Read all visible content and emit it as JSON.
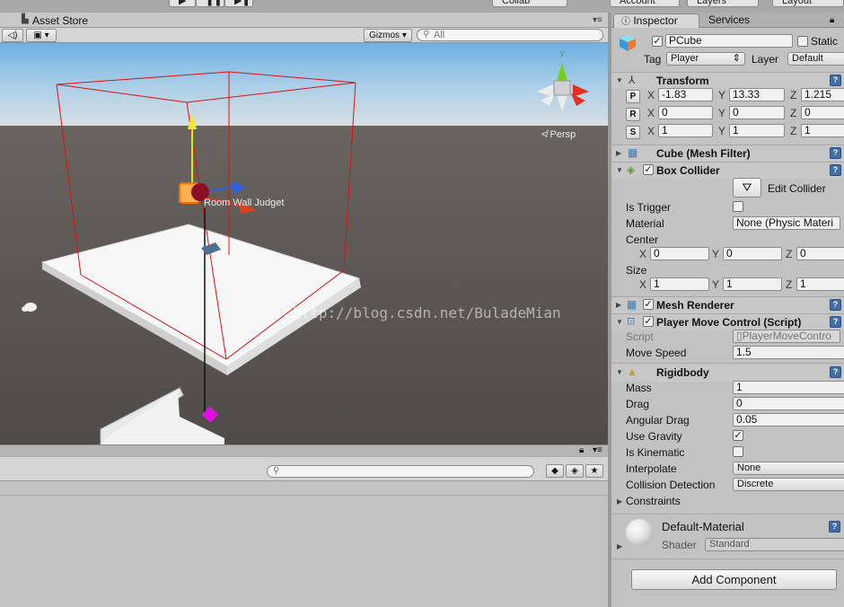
{
  "top": {
    "btn_collab": "Collab",
    "btn_account": "Account",
    "btn_layers": "Layers",
    "btn_layout": "Layout"
  },
  "scene": {
    "tab_asset_store": "Asset Store",
    "gizmos": "Gizmos",
    "search_placeholder": "All",
    "persp": "Persp",
    "object_label": "Room Wall Judget",
    "watermark": "http://blog.csdn.net/BuladeMian"
  },
  "inspector": {
    "tabs": [
      "Inspector",
      "Services"
    ],
    "object": {
      "name": "PCube",
      "static_label": "Static",
      "tag_label": "Tag",
      "tag_value": "Player",
      "layer_label": "Layer",
      "layer_value": "Default"
    },
    "transform": {
      "title": "Transform",
      "rows": [
        {
          "btn": "P",
          "x": "-1.83",
          "y": "13.33",
          "z": "1.215"
        },
        {
          "btn": "R",
          "x": "0",
          "y": "0",
          "z": "0"
        },
        {
          "btn": "S",
          "x": "1",
          "y": "1",
          "z": "1"
        }
      ]
    },
    "mesh_filter": {
      "title": "Cube (Mesh Filter)"
    },
    "box_collider": {
      "title": "Box Collider",
      "edit_collider": "Edit Collider",
      "is_trigger": "Is Trigger",
      "material": "Material",
      "material_value": "None (Physic Materi",
      "center": "Center",
      "center_x": "0",
      "center_y": "0",
      "center_z": "0",
      "size": "Size",
      "size_x": "1",
      "size_y": "1",
      "size_z": "1"
    },
    "mesh_renderer": {
      "title": "Mesh Renderer"
    },
    "player_move": {
      "title": "Player Move Control (Script)",
      "script_label": "Script",
      "script_value": "PlayerMoveContro",
      "move_speed_label": "Move Speed",
      "move_speed": "1.5"
    },
    "rigidbody": {
      "title": "Rigidbody",
      "mass_label": "Mass",
      "mass": "1",
      "drag_label": "Drag",
      "drag": "0",
      "angular_drag_label": "Angular Drag",
      "angular_drag": "0.05",
      "use_gravity_label": "Use Gravity",
      "is_kinematic_label": "Is Kinematic",
      "interpolate_label": "Interpolate",
      "interpolate": "None",
      "collision_label": "Collision Detection",
      "collision": "Discrete",
      "constraints_label": "Constraints"
    },
    "material": {
      "name": "Default-Material",
      "shader_label": "Shader",
      "shader": "Standard"
    },
    "add_component": "Add Component"
  },
  "colors": {
    "accent": "#3f6ea8",
    "bounds": "#e01010"
  }
}
